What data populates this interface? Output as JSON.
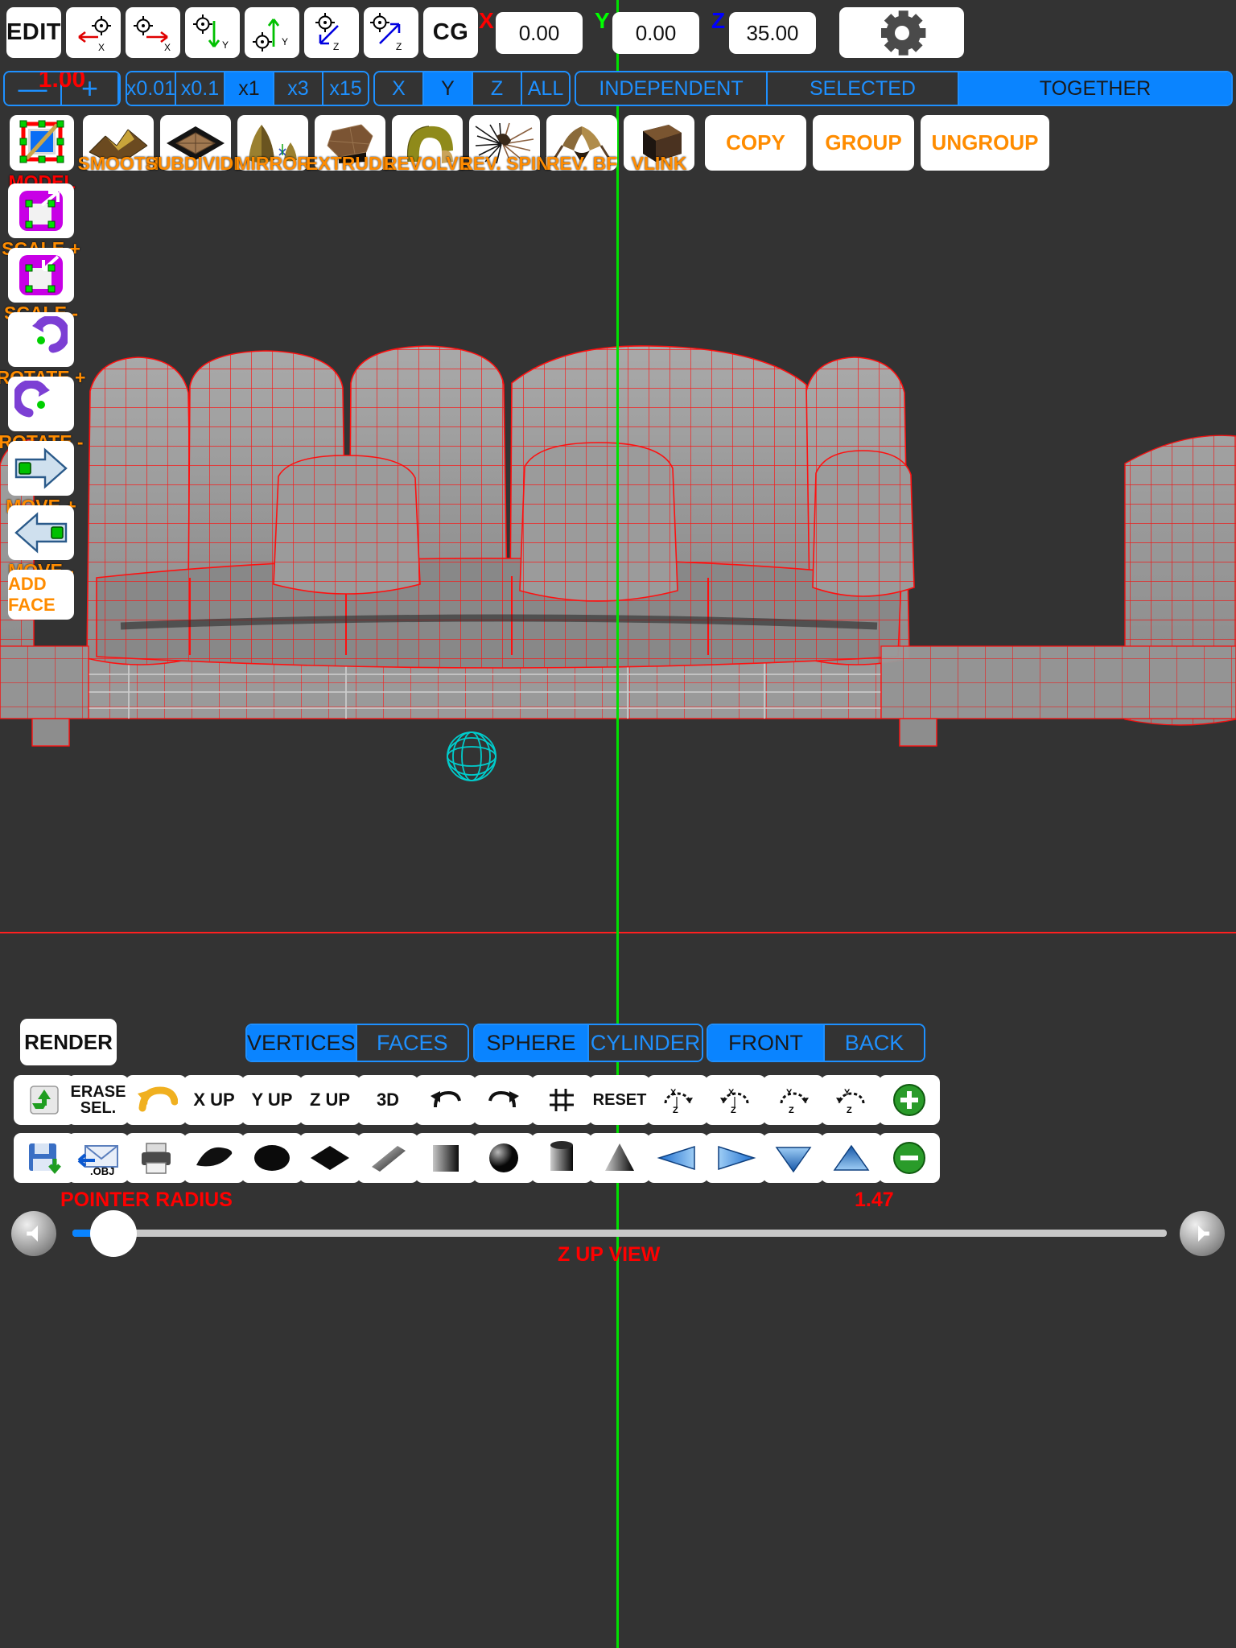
{
  "toolbar_top": {
    "edit_label": "EDIT",
    "cg_label": "CG",
    "nudge_buttons": [
      {
        "name": "move-minus-x",
        "axis": "X",
        "dir": "left",
        "color": "#ff0000"
      },
      {
        "name": "move-plus-x",
        "axis": "X",
        "dir": "right",
        "color": "#ff0000"
      },
      {
        "name": "move-minus-y",
        "axis": "Y",
        "dir": "down",
        "color": "#00cc00"
      },
      {
        "name": "move-plus-y",
        "axis": "Y",
        "dir": "up",
        "color": "#00cc00"
      },
      {
        "name": "move-minus-z",
        "axis": "Z",
        "dir": "downleft",
        "color": "#0000ff"
      },
      {
        "name": "move-plus-z",
        "axis": "Z",
        "dir": "upright",
        "color": "#0000ff"
      }
    ],
    "coords": [
      {
        "axis": "X",
        "value": "0.00",
        "color": "#ff0000"
      },
      {
        "axis": "Y",
        "value": "0.00",
        "color": "#00ff00"
      },
      {
        "axis": "Z",
        "value": "35.00",
        "color": "#0000ff"
      }
    ],
    "settings_icon": "gear-icon"
  },
  "toolbar_step": {
    "step_value": "1.00",
    "minus_label": "—",
    "plus_label": "+",
    "multipliers": [
      {
        "label": "x0.01",
        "selected": false
      },
      {
        "label": "x0.1",
        "selected": false
      },
      {
        "label": "x1",
        "selected": true
      },
      {
        "label": "x3",
        "selected": false
      },
      {
        "label": "x15",
        "selected": false
      }
    ],
    "axes": [
      {
        "label": "X",
        "selected": false
      },
      {
        "label": "Y",
        "selected": true
      },
      {
        "label": "Z",
        "selected": false
      },
      {
        "label": "ALL",
        "selected": false
      }
    ],
    "modes": [
      {
        "label": "INDEPENDENT",
        "selected": false
      },
      {
        "label": "SELECTED",
        "selected": false
      },
      {
        "label": "TOGETHER",
        "selected": true
      }
    ]
  },
  "toolbar_ops": {
    "icon_buttons": [
      {
        "label": "MODEL",
        "icon": "model-pencil-icon",
        "label_color": "#ff0000"
      },
      {
        "label": "SMOOTH",
        "icon": "smooth-mesh-icon",
        "label_color": "#ff8c00"
      },
      {
        "label": "SUBDIVIDE",
        "icon": "subdivide-icon",
        "label_color": "#ff8c00"
      },
      {
        "label": "MIRROR",
        "icon": "mirror-icon",
        "label_color": "#ff8c00"
      },
      {
        "label": "EXTRUDE",
        "icon": "extrude-icon",
        "label_color": "#ff8c00"
      },
      {
        "label": "REVOLVE",
        "icon": "revolve-icon",
        "label_color": "#ff8c00"
      },
      {
        "label": "REV. SPIN",
        "icon": "rev-spin-icon",
        "label_color": "#ff8c00"
      },
      {
        "label": "REV. BF",
        "icon": "rev-bf-icon",
        "label_color": "#ff8c00"
      },
      {
        "label": "VLINK",
        "icon": "vlink-icon",
        "label_color": "#ff8c00"
      }
    ],
    "text_buttons": [
      {
        "label": "COPY"
      },
      {
        "label": "GROUP"
      },
      {
        "label": "UNGROUP"
      }
    ]
  },
  "sidebar": {
    "items": [
      {
        "label": "SCALE +",
        "icon": "scale-up-icon",
        "label_color": "#ff8c00"
      },
      {
        "label": "SCALE -",
        "icon": "scale-down-icon",
        "label_color": "#ff8c00"
      },
      {
        "label": "ROTATE +",
        "icon": "rotate-ccw-icon",
        "label_color": "#ff8c00"
      },
      {
        "label": "ROTATE -",
        "icon": "rotate-cw-icon",
        "label_color": "#ff8c00"
      },
      {
        "label": "MOVE +",
        "icon": "move-right-icon",
        "label_color": "#ff8c00"
      },
      {
        "label": "MOVE -",
        "icon": "move-left-icon",
        "label_color": "#ff8c00"
      }
    ],
    "add_face_label": "ADD FACE"
  },
  "bottom": {
    "render_label": "RENDER",
    "seg_select": [
      {
        "label": "VERTICES",
        "selected": true
      },
      {
        "label": "FACES",
        "selected": false
      }
    ],
    "seg_primitive": [
      {
        "label": "SPHERE",
        "selected": false
      },
      {
        "label": "CYLINDER",
        "selected": false
      }
    ],
    "seg_facing": [
      {
        "label": "FRONT",
        "selected": true
      },
      {
        "label": "BACK",
        "selected": false
      }
    ],
    "row_a": [
      {
        "label": "",
        "icon": "trash-recycle-icon"
      },
      {
        "label": "ERASE\nSEL.",
        "icon": "erase-selection-icon"
      },
      {
        "label": "",
        "icon": "undo-arrow-yellow-icon"
      },
      {
        "label": "X UP",
        "icon": "x-up-icon"
      },
      {
        "label": "Y UP",
        "icon": "y-up-icon"
      },
      {
        "label": "Z UP",
        "icon": "z-up-icon"
      },
      {
        "label": "3D",
        "icon": "three-d-icon"
      },
      {
        "label": "",
        "icon": "undo-icon"
      },
      {
        "label": "",
        "icon": "redo-icon"
      },
      {
        "label": "",
        "icon": "fit-icon"
      },
      {
        "label": "RESET",
        "icon": "reset-icon"
      },
      {
        "label": "",
        "icon": "rotate-x-z-icon"
      },
      {
        "label": "",
        "icon": "rotate-x-z-alt-icon"
      },
      {
        "label": "",
        "icon": "rotate-y-z-icon"
      },
      {
        "label": "",
        "icon": "rotate-y-z-alt-icon"
      },
      {
        "label": "",
        "icon": "plus-circle-green-icon"
      }
    ],
    "row_b": [
      {
        "label": "",
        "icon": "save-disk-icon"
      },
      {
        "label": ".OBJ",
        "icon": "import-obj-icon"
      },
      {
        "label": "",
        "icon": "print-icon"
      },
      {
        "label": "",
        "icon": "plane-black-icon"
      },
      {
        "label": "",
        "icon": "sphere-black-icon"
      },
      {
        "label": "",
        "icon": "diamond-black-icon"
      },
      {
        "label": "",
        "icon": "slab-black-icon"
      },
      {
        "label": "",
        "icon": "cube-black-icon"
      },
      {
        "label": "",
        "icon": "hemisphere-black-icon"
      },
      {
        "label": "",
        "icon": "cylinder-black-icon"
      },
      {
        "label": "",
        "icon": "cone-black-icon"
      },
      {
        "label": "",
        "icon": "triangle-left-blue-icon"
      },
      {
        "label": "",
        "icon": "triangle-right-blue-icon"
      },
      {
        "label": "",
        "icon": "triangle-down-blue-icon"
      },
      {
        "label": "",
        "icon": "triangle-up-blue-icon"
      },
      {
        "label": "",
        "icon": "minus-circle-green-icon"
      }
    ],
    "slider": {
      "label": "POINTER RADIUS",
      "value": "1.47",
      "prev_icon": "arrow-left-icon",
      "next_icon": "arrow-right-icon"
    },
    "view_label": "Z UP VIEW"
  }
}
